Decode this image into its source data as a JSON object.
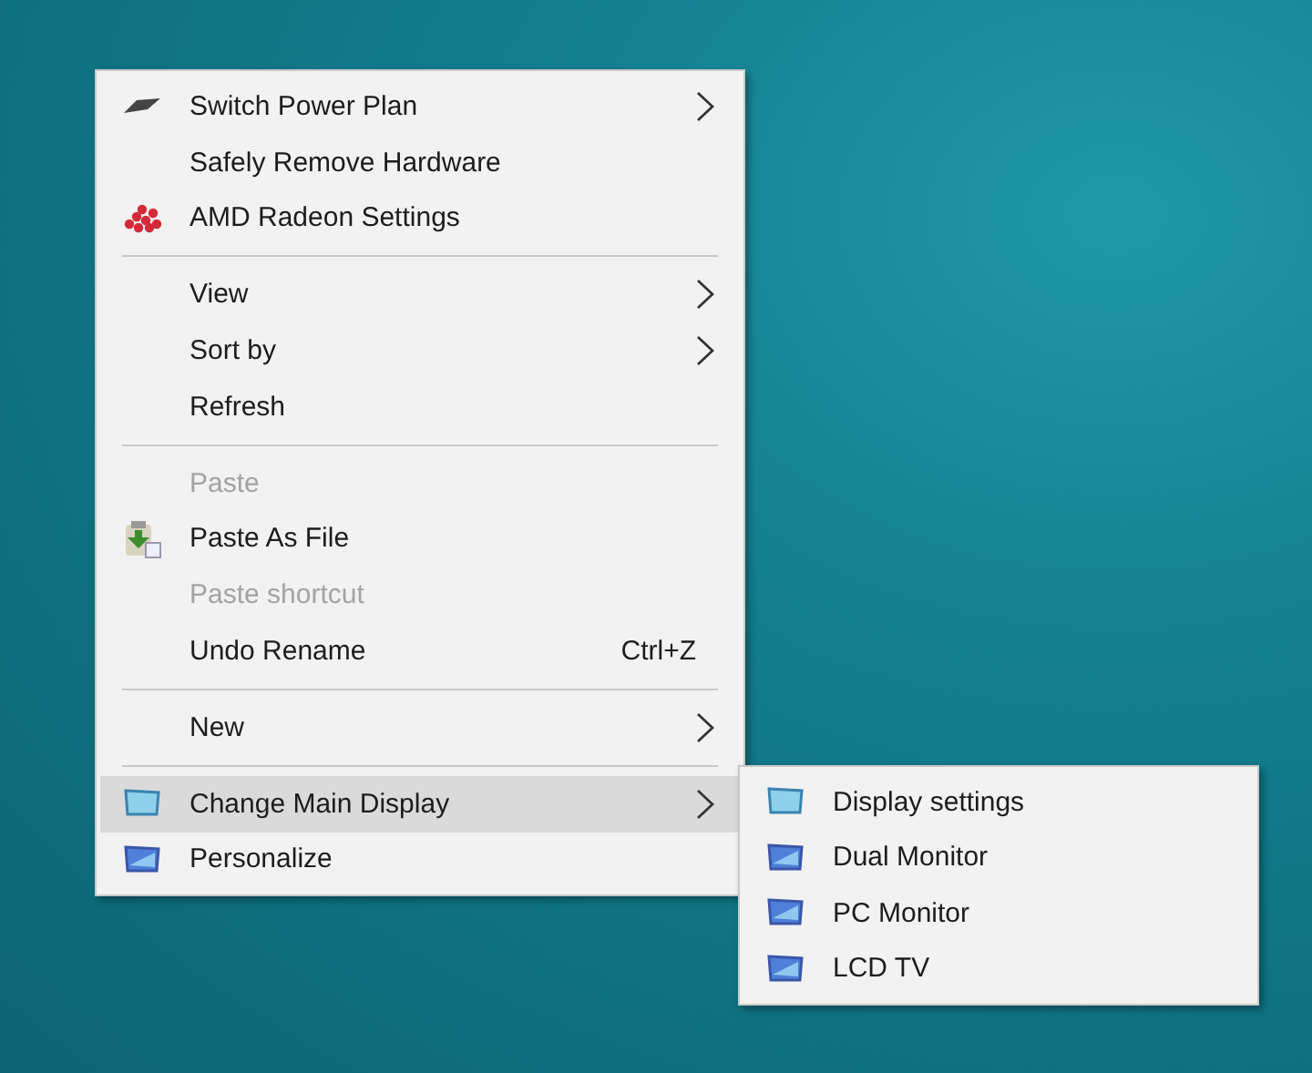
{
  "context_menu": {
    "items": [
      {
        "kind": "item",
        "label": "Switch Power Plan",
        "submenu": true,
        "disabled": false,
        "selected": false
      },
      {
        "kind": "item",
        "label": "Safely Remove Hardware",
        "disabled": false,
        "selected": false
      },
      {
        "kind": "item",
        "label": "AMD Radeon Settings",
        "disabled": false,
        "selected": false
      },
      {
        "kind": "separator"
      },
      {
        "kind": "item",
        "label": "View",
        "submenu": true,
        "disabled": false,
        "selected": false
      },
      {
        "kind": "item",
        "label": "Sort by",
        "submenu": true,
        "disabled": false,
        "selected": false
      },
      {
        "kind": "item",
        "label": "Refresh",
        "disabled": false,
        "selected": false
      },
      {
        "kind": "separator"
      },
      {
        "kind": "item",
        "label": "Paste",
        "disabled": true,
        "selected": false
      },
      {
        "kind": "item",
        "label": "Paste As File",
        "disabled": false,
        "selected": false
      },
      {
        "kind": "item",
        "label": "Paste shortcut",
        "disabled": true,
        "selected": false
      },
      {
        "kind": "item",
        "label": "Undo Rename",
        "shortcut": "Ctrl+Z",
        "disabled": false,
        "selected": false
      },
      {
        "kind": "separator"
      },
      {
        "kind": "item",
        "label": "New",
        "submenu": true,
        "disabled": false,
        "selected": false
      },
      {
        "kind": "separator"
      },
      {
        "kind": "item",
        "label": "Change Main Display",
        "submenu": true,
        "disabled": false,
        "selected": true
      },
      {
        "kind": "item",
        "label": "Personalize",
        "disabled": false,
        "selected": false
      }
    ]
  },
  "submenu": {
    "items": [
      {
        "kind": "item",
        "label": "Display settings",
        "disabled": false,
        "selected": false
      },
      {
        "kind": "item",
        "label": "Dual Monitor",
        "disabled": false,
        "selected": false
      },
      {
        "kind": "item",
        "label": "PC Monitor",
        "disabled": false,
        "selected": false
      },
      {
        "kind": "item",
        "label": "LCD TV",
        "disabled": false,
        "selected": false
      }
    ]
  }
}
